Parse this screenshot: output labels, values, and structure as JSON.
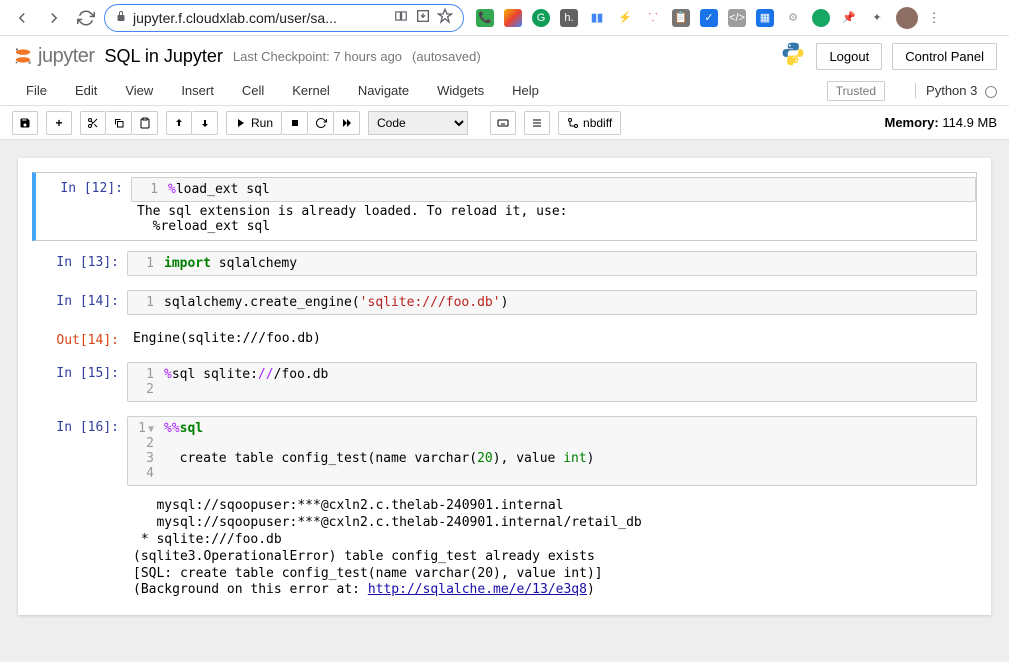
{
  "browser": {
    "url": "jupyter.f.cloudxlab.com/user/sa..."
  },
  "header": {
    "logo_text": "jupyter",
    "title": "SQL in Jupyter",
    "checkpoint": "Last Checkpoint: 7 hours ago",
    "autosave": "(autosaved)",
    "logout": "Logout",
    "control_panel": "Control Panel"
  },
  "menu": {
    "items": [
      "File",
      "Edit",
      "View",
      "Insert",
      "Cell",
      "Kernel",
      "Navigate",
      "Widgets",
      "Help"
    ],
    "trusted": "Trusted",
    "kernel": "Python 3"
  },
  "toolbar": {
    "run": "Run",
    "cell_type": "Code",
    "nbdiff": "nbdiff",
    "memory_label": "Memory:",
    "memory_value": "114.9 MB"
  },
  "cells": {
    "c12": {
      "prompt": "In [12]:",
      "gutter": "1",
      "code_html": "<span class='cm-op'>%</span>load_ext sql",
      "output": "The sql extension is already loaded. To reload it, use:\n  %reload_ext sql"
    },
    "c13": {
      "prompt": "In [13]:",
      "gutter": "1",
      "code_html": "<span class='cm-keyword'>import</span> sqlalchemy"
    },
    "c14": {
      "prompt": "In [14]:",
      "gutter": "1",
      "code_html": "sqlalchemy.create_engine(<span class='cm-string'>'sqlite:///foo.db'</span>)",
      "out_prompt": "Out[14]:",
      "output": "Engine(sqlite:///foo.db)"
    },
    "c15": {
      "prompt": "In [15]:",
      "lines": [
        {
          "n": "1",
          "html": "<span class='cm-op'>%</span>sql sqlite:<span class='cm-op'>//</span>/foo.db"
        },
        {
          "n": "2",
          "html": ""
        }
      ]
    },
    "c16": {
      "prompt": "In [16]:",
      "lines": [
        {
          "n": "1",
          "fold": "▼",
          "html": "<span class='cm-op'>%%</span><span class='cm-keyword'>sql</span>"
        },
        {
          "n": "2",
          "html": ""
        },
        {
          "n": "3",
          "html": "  create table config_test(name varchar(<span class='cm-number'>20</span>), value <span class='cm-number'>int</span>)"
        },
        {
          "n": "4",
          "html": ""
        }
      ],
      "output_pre": "   mysql://sqoopuser:***@cxln2.c.thelab-240901.internal\n   mysql://sqoopuser:***@cxln2.c.thelab-240901.internal/retail_db\n * sqlite:///foo.db\n(sqlite3.OperationalError) table config_test already exists\n[SQL: create table config_test(name varchar(20), value int)]\n(Background on this error at: ",
      "output_link": "http://sqlalche.me/e/13/e3q8",
      "output_post": ")"
    }
  }
}
